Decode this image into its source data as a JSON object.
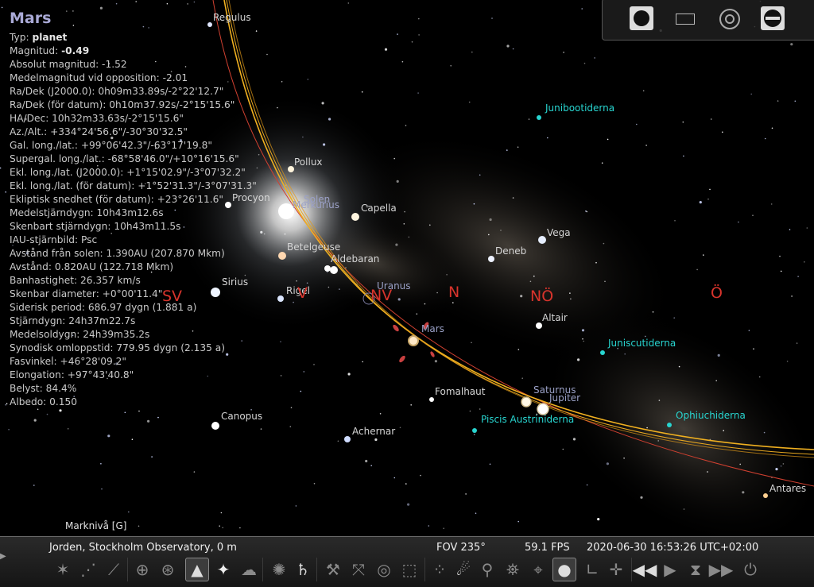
{
  "object": {
    "title": "Mars",
    "rows": [
      {
        "label": "Typ:",
        "value": "planet",
        "bold": true
      },
      {
        "label": "Magnitud:",
        "value": "-0.49",
        "bold": true
      },
      {
        "label": "Absolut magnitud: -1.52"
      },
      {
        "label": "Medelmagnitud vid opposition: -2.01"
      },
      {
        "label": "Ra/Dek (J2000.0): 0h09m33.89s/-2°22'12.7\""
      },
      {
        "label": "Ra/Dek (för datum): 0h10m37.92s/-2°15'15.6\""
      },
      {
        "label": "HA/Dec: 10h32m33.63s/-2°15'15.6\""
      },
      {
        "label": "Az./Alt.: +334°24'56.6\"/-30°30'32.5\""
      },
      {
        "label": "Gal. long./lat.: +99°06'42.3\"/-63°17'19.8\""
      },
      {
        "label": "Supergal. long./lat.: -68°58'46.0\"/+10°16'15.6\""
      },
      {
        "label": "Ekl. long./lat. (J2000.0): +1°15'02.9\"/-3°07'32.2\""
      },
      {
        "label": "Ekl. long./lat. (för datum): +1°52'31.3\"/-3°07'31.3\""
      },
      {
        "label": "Ekliptisk snedhet (för datum): +23°26'11.6\""
      },
      {
        "label": "Medelstjärndygn: 10h43m12.6s"
      },
      {
        "label": "Skenbart stjärndygn: 10h43m11.5s"
      },
      {
        "label": "IAU-stjärnbild: Psc"
      },
      {
        "label": "Avstånd från solen: 1.390AU (207.870 Mkm)"
      },
      {
        "label": "Avstånd: 0.820AU (122.718 Mkm)"
      },
      {
        "label": "Banhastighet: 26.357 km/s"
      },
      {
        "label": "Skenbar diameter: +0°00'11.4\""
      },
      {
        "label": "Siderisk period: 686.97 dygn (1.881 a)"
      },
      {
        "label": "Stjärndygn: 24h37m22.7s"
      },
      {
        "label": "Medelsoldygn: 24h39m35.2s"
      },
      {
        "label": "Synodisk omloppstid: 779.95 dygn (2.135 a)"
      },
      {
        "label": "Fasvinkel: +46°28'09.2\""
      },
      {
        "label": "Elongation: +97°43'40.8\""
      },
      {
        "label": "Belyst: 84.4%"
      },
      {
        "label": "Albedo: 0.150"
      }
    ]
  },
  "labels": {
    "stars": [
      "Regulus",
      "Pollux",
      "Procyon",
      "Capella",
      "Betelgeuse",
      "Aldebaran",
      "Sirius",
      "Rigel",
      "Vega",
      "Deneb",
      "Altair",
      "Fomalhaut",
      "Canopus",
      "Achernar",
      "Antares"
    ],
    "planets": [
      "Solen",
      "Merkurius",
      "Uranus",
      "Mars",
      "Saturnus",
      "Jupiter"
    ],
    "constellations": [
      "Junibootiderna",
      "Juniscutiderna",
      "Piscis Austriniderna",
      "Ophiuchiderna"
    ],
    "cardinals": [
      "SV",
      "V",
      "NV",
      "N",
      "NÖ",
      "Ö"
    ],
    "ground": "Marknivå  [G]"
  },
  "status": {
    "location": "Jorden, Stockholm Observatory, 0 m",
    "fov": "FOV 235°",
    "fps": "59.1 FPS",
    "datetime": "2020-06-30 16:53:26 UTC+02:00"
  },
  "colors": {
    "cardinal": "#d8342c",
    "constellation": "#28d5d0",
    "ecliptic": "#f0b020",
    "equator": "#d04030"
  }
}
